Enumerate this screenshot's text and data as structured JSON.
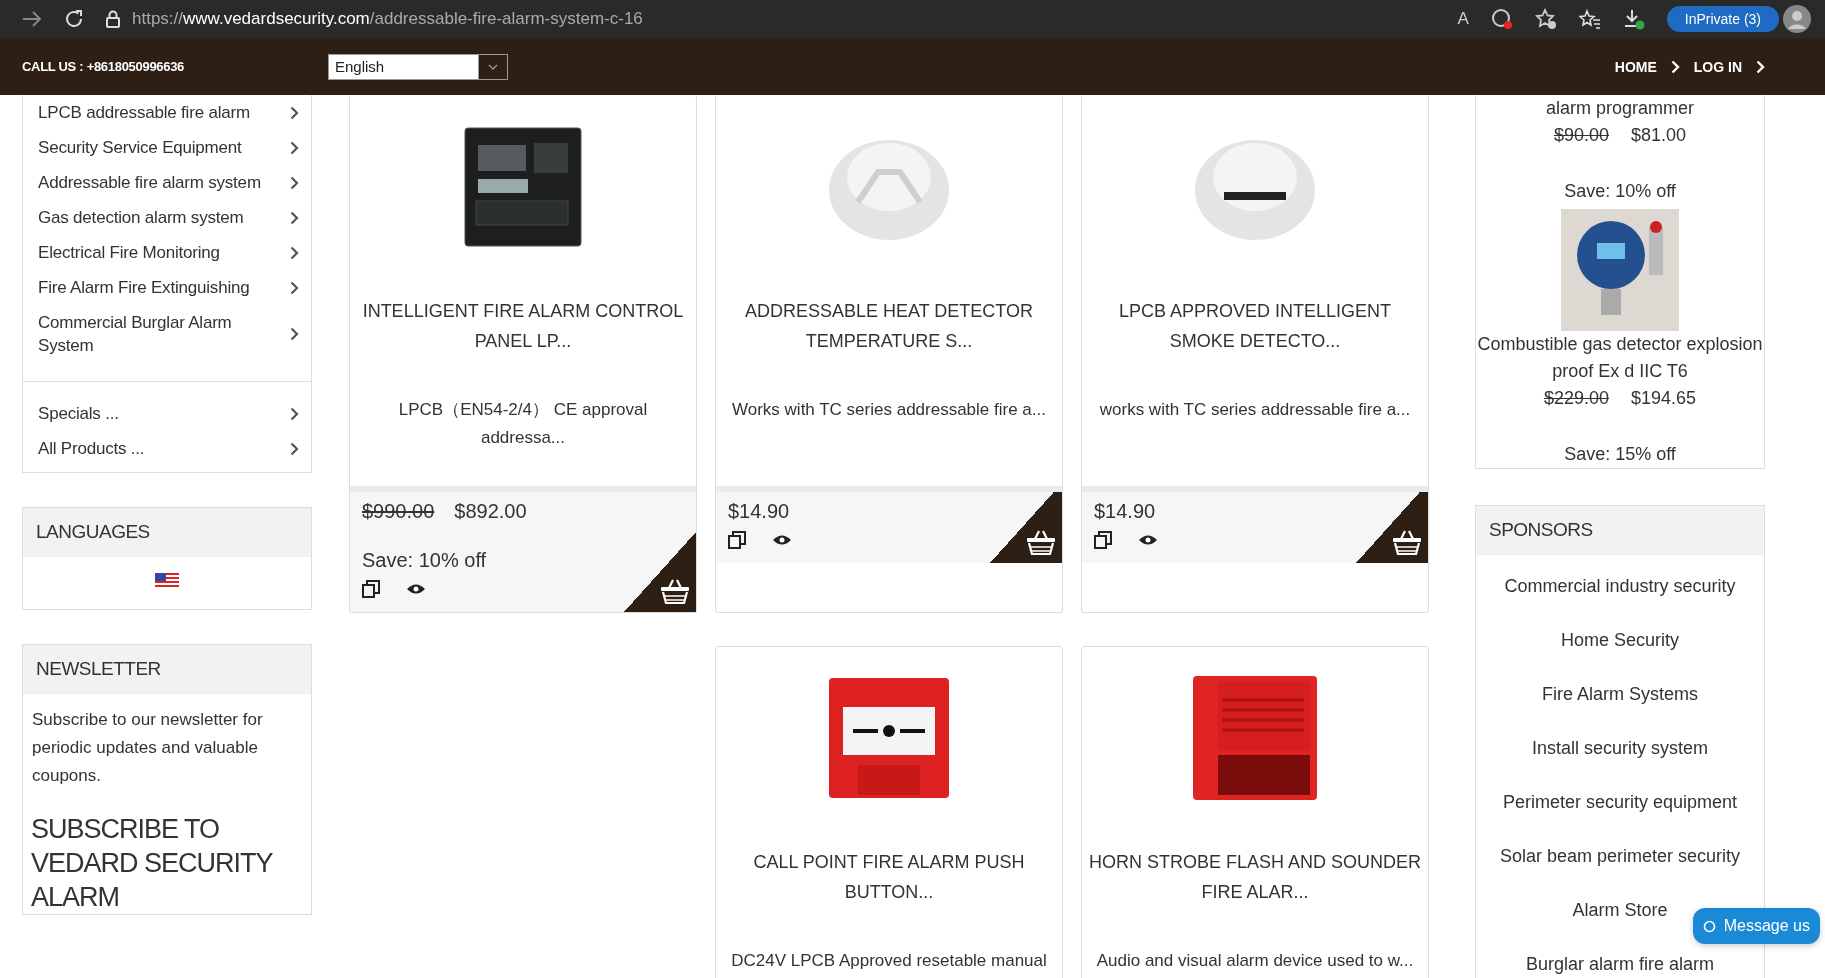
{
  "browser": {
    "url_prefix": "https://",
    "url_domain": "www.vedardsecurity.com",
    "url_path": "/addressable-fire-alarm-system-c-16",
    "read_aloud": "A",
    "inprivate": "InPrivate (3)"
  },
  "header": {
    "call": "CALL US : +8618050996636",
    "language": "English",
    "nav": [
      "HOME",
      "LOG IN"
    ]
  },
  "categories": [
    {
      "label": "LPCB addressable fire alarm"
    },
    {
      "label": "Security Service Equipment"
    },
    {
      "label": "Addressable fire alarm system"
    },
    {
      "label": "Gas detection alarm system"
    },
    {
      "label": "Electrical Fire Monitoring"
    },
    {
      "label": "Fire Alarm Fire Extinguishing"
    },
    {
      "label": "Commercial Burglar Alarm System"
    }
  ],
  "more_links": [
    {
      "label": "Specials ..."
    },
    {
      "label": "All Products ..."
    }
  ],
  "languages": {
    "title": "LANGUAGES"
  },
  "newsletter": {
    "title": "NEWSLETTER",
    "text": "Subscribe to our newsletter for periodic updates and valuable coupons.",
    "heading": "SUBSCRIBE TO VEDARD SECURITY ALARM"
  },
  "product_rows": [
    {
      "products": [
        {
          "kind": "control-panel",
          "name": "INTELLIGENT FIRE ALARM CONTROL PANEL LP...",
          "description": "LPCB（EN54-2/4） CE approval addressa...",
          "old_price": "$990.00",
          "price": "$892.00",
          "save": "Save: 10% off"
        },
        {
          "kind": "heat-detector",
          "name": "ADDRESSABLE HEAT DETECTOR TEMPERATURE S...",
          "description": "Works with TC series addressable fire a...",
          "price": "$14.90"
        },
        {
          "kind": "smoke-detector",
          "name": "LPCB APPROVED INTELLIGENT SMOKE DETECTO...",
          "description": "works with TC series addressable fire a...",
          "price": "$14.90"
        }
      ]
    },
    {
      "products": [
        {
          "kind": "call-point",
          "name": "CALL POINT FIRE ALARM PUSH BUTTON...",
          "description": "DC24V LPCB Approved resetable manual"
        },
        {
          "kind": "horn-strobe",
          "name": "HORN STROBE FLASH AND SOUNDER FIRE ALAR...",
          "description": "Audio and visual alarm device used to w..."
        }
      ]
    }
  ],
  "specials": [
    {
      "name": "alarm programmer",
      "old_price": "$90.00",
      "price": "$81.00",
      "save": "Save: 10% off"
    },
    {
      "kind": "gas-detector",
      "name": "Combustible gas detector explosion proof Ex d IIC T6",
      "old_price": "$229.00",
      "price": "$194.65",
      "save": "Save: 15% off"
    }
  ],
  "sponsors": {
    "title": "SPONSORS",
    "items": [
      "Commercial industry security",
      "Home Security",
      "Fire Alarm Systems",
      "Install security system",
      "Perimeter security equipment",
      "Solar beam perimeter security",
      "Alarm Store",
      "Burglar alarm fire alarm"
    ]
  },
  "chat": {
    "label": "Message us"
  }
}
